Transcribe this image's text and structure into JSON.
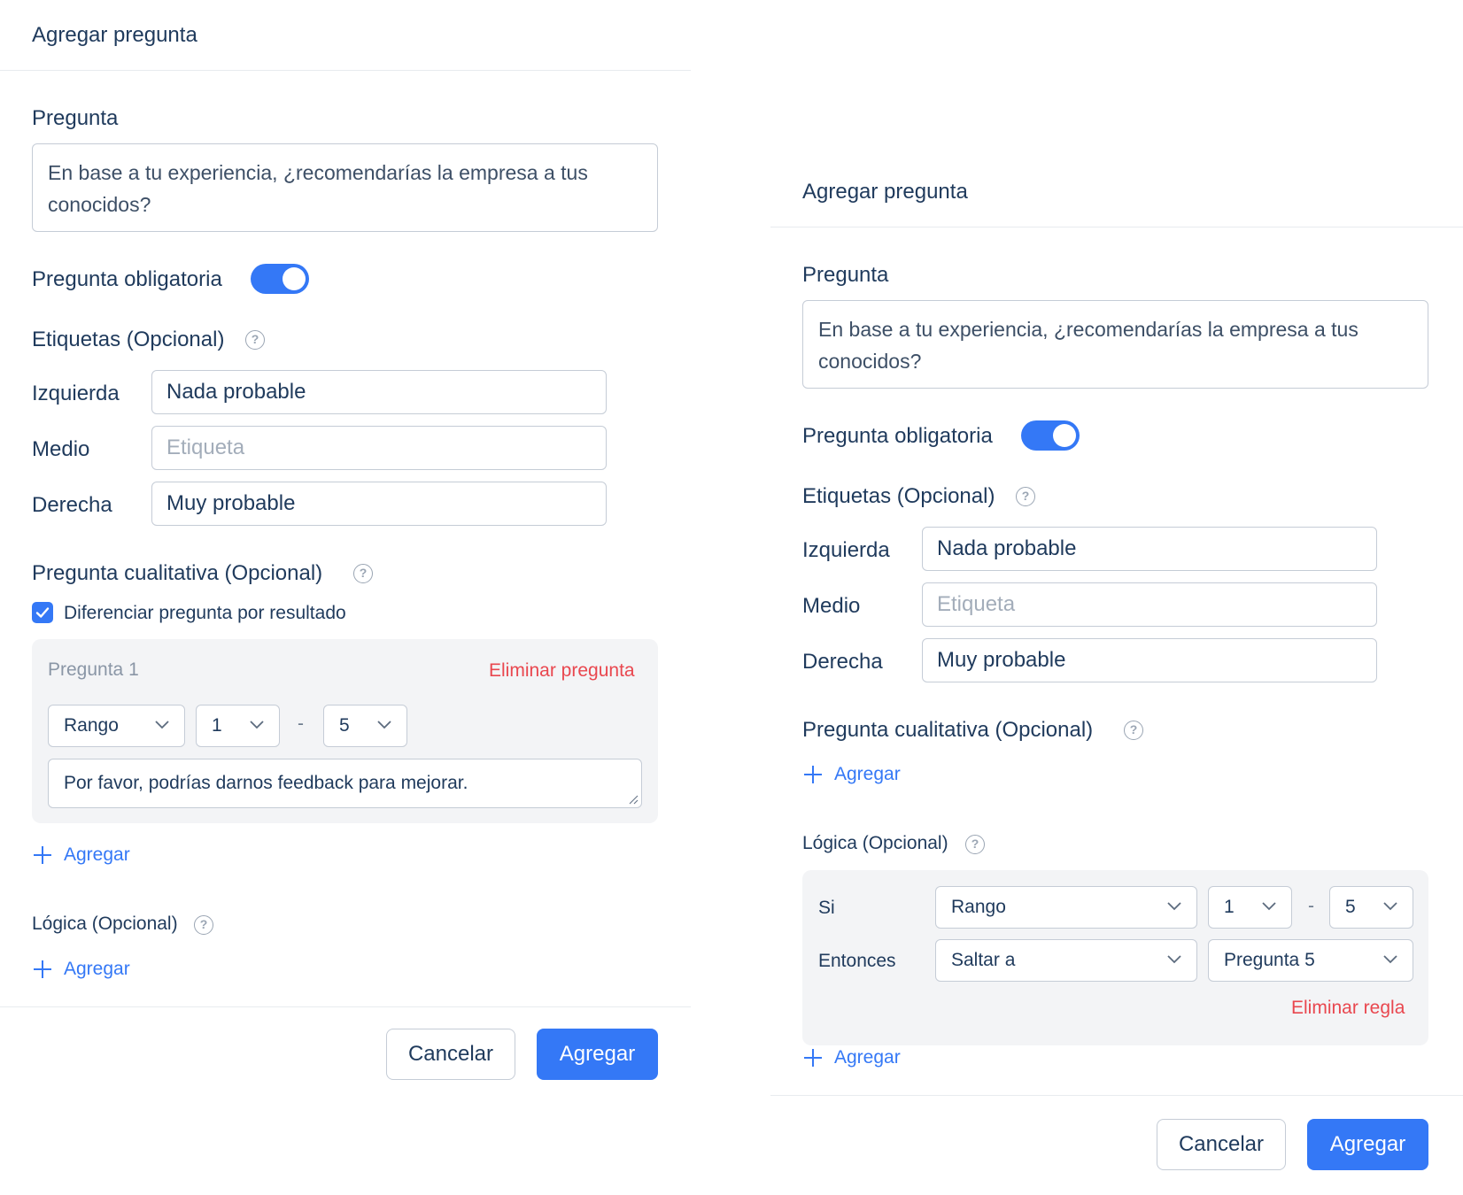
{
  "panel_left": {
    "title": "Agregar pregunta",
    "question_label": "Pregunta",
    "question_text": "En base a tu experiencia, ¿recomendarías la empresa a tus conocidos?",
    "required_label": "Pregunta obligatoria",
    "required_on": true,
    "labels_heading": "Etiquetas (Opcional)",
    "labels": [
      {
        "label": "Izquierda",
        "value": "Nada probable",
        "placeholder": ""
      },
      {
        "label": "Medio",
        "value": "",
        "placeholder": "Etiqueta"
      },
      {
        "label": "Derecha",
        "value": "Muy probable",
        "placeholder": ""
      }
    ],
    "qualitative_heading": "Pregunta cualitativa (Opcional)",
    "differentiate_label": "Diferenciar pregunta por resultado",
    "differentiate_checked": true,
    "subquestion": {
      "title": "Pregunta 1",
      "delete_label": "Eliminar pregunta",
      "type_value": "Rango",
      "from_value": "1",
      "separator": "-",
      "to_value": "5",
      "text": "Por favor, podrías darnos feedback para mejorar."
    },
    "add_label": "Agregar",
    "logic_heading": "Lógica (Opcional)",
    "logic_add_label": "Agregar",
    "cancel_label": "Cancelar",
    "submit_label": "Agregar"
  },
  "panel_right": {
    "title": "Agregar pregunta",
    "question_label": "Pregunta",
    "question_text": "En base a tu experiencia, ¿recomendarías la empresa a tus conocidos?",
    "required_label": "Pregunta obligatoria",
    "required_on": true,
    "labels_heading": "Etiquetas (Opcional)",
    "labels": [
      {
        "label": "Izquierda",
        "value": "Nada probable",
        "placeholder": ""
      },
      {
        "label": "Medio",
        "value": "",
        "placeholder": "Etiqueta"
      },
      {
        "label": "Derecha",
        "value": "Muy probable",
        "placeholder": ""
      }
    ],
    "qualitative_heading": "Pregunta cualitativa (Opcional)",
    "qualitative_add_label": "Agregar",
    "logic_heading": "Lógica (Opcional)",
    "rule": {
      "if_label": "Si",
      "if_type": "Rango",
      "from_value": "1",
      "separator": "-",
      "to_value": "5",
      "then_label": "Entonces",
      "then_action": "Saltar a",
      "then_target": "Pregunta 5",
      "delete_label": "Eliminar regla"
    },
    "logic_add_label": "Agregar",
    "cancel_label": "Cancelar",
    "submit_label": "Agregar"
  },
  "colors": {
    "primary": "#3478f6",
    "danger": "#e9474f",
    "text": "#1f3a5c",
    "border": "#c5ccd6",
    "panel_grey": "#f3f4f6"
  },
  "icons": [
    "help-icon",
    "chevron-down-icon",
    "plus-icon",
    "check-icon",
    "resize-grip-icon"
  ]
}
